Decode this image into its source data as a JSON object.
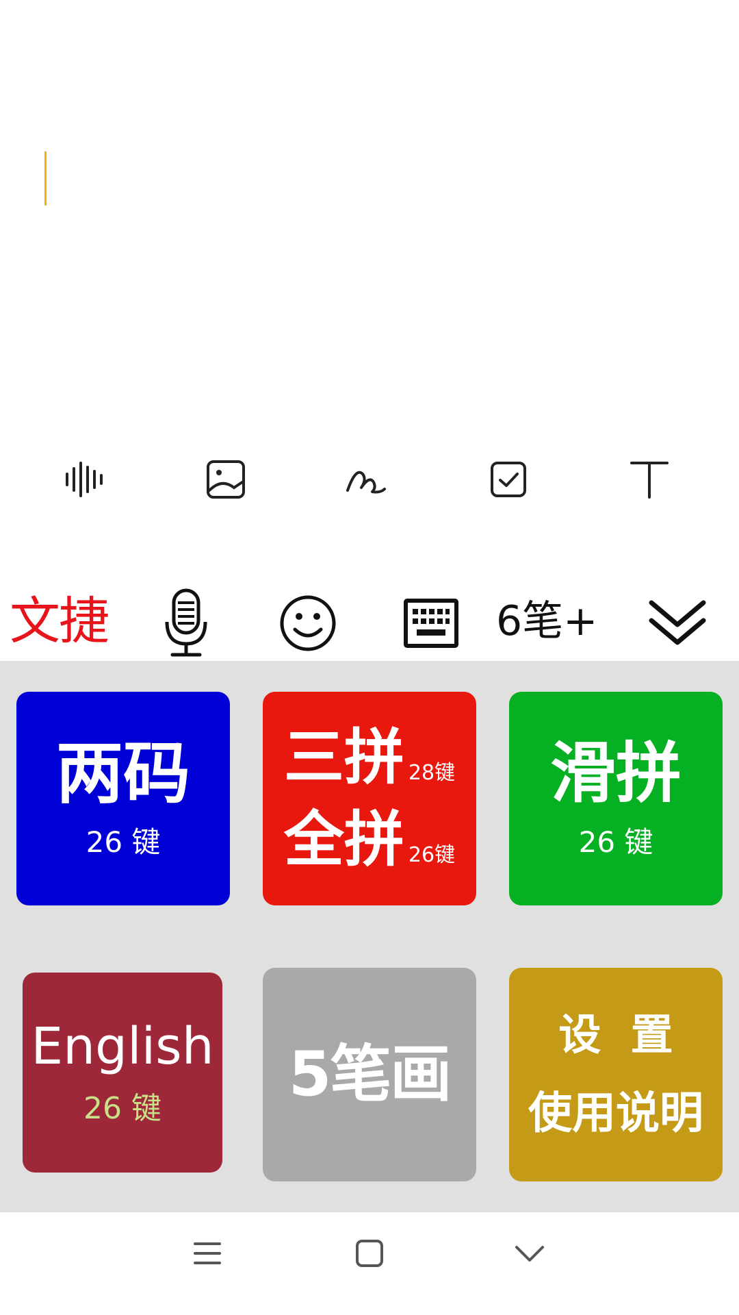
{
  "editor": {
    "text": ""
  },
  "note_toolbar": {
    "items": [
      "voice-wave",
      "image",
      "handwriting",
      "checkbox",
      "text-style"
    ]
  },
  "ime_bar": {
    "brand": "文捷",
    "stroke_plus": "6笔+"
  },
  "layouts": {
    "liangma": {
      "title": "两码",
      "sub": "26 键",
      "color": "#0000d6"
    },
    "sanpin": {
      "line1": "三拼",
      "line1_sub": "28键",
      "line2": "全拼",
      "line2_sub": "26键",
      "color": "#e8180e"
    },
    "huapin": {
      "title": "滑拼",
      "sub": "26 键",
      "color": "#05b022"
    },
    "english": {
      "title": "English",
      "sub": "26 键",
      "color": "#9e283a",
      "sub_color": "#c8e088"
    },
    "stroke5": {
      "title": "5笔画",
      "color": "#a9a9a9"
    },
    "settings": {
      "line1": "设  置",
      "line2": "使用说明",
      "color": "#c49a17"
    }
  },
  "colors": {
    "panel_bg": "#e0e0e0",
    "cursor": "#f0b400",
    "brand": "#e8141b"
  }
}
